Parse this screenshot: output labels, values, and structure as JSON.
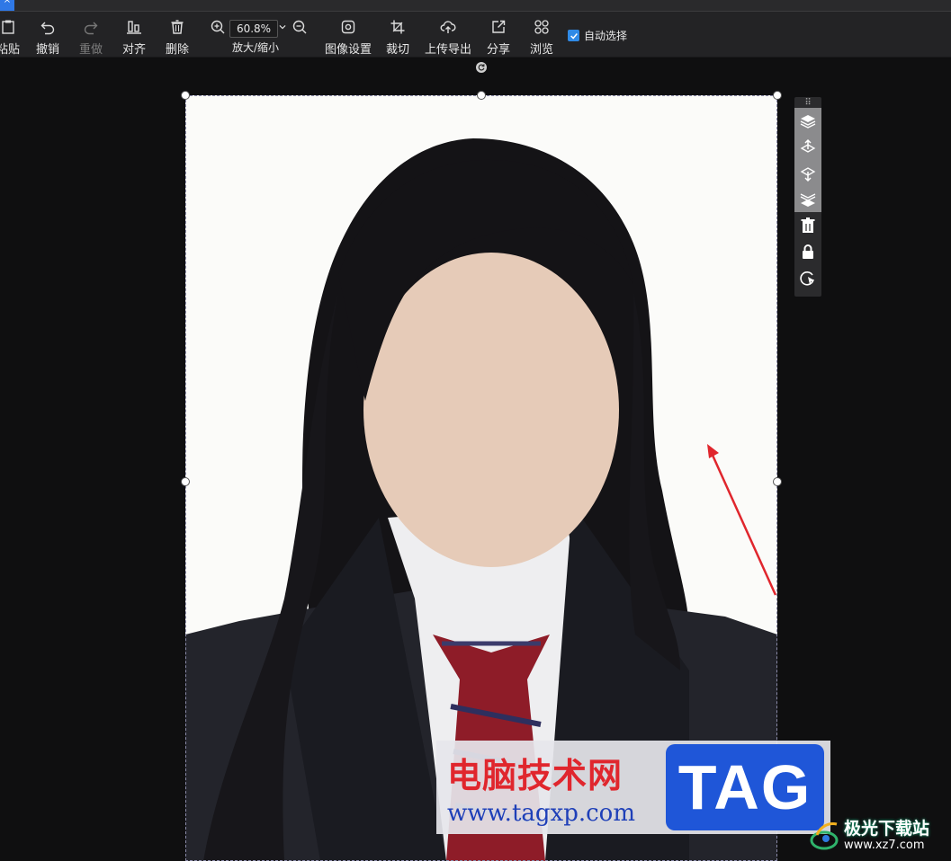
{
  "top_tab_glyph": "^",
  "toolbar": {
    "items": [
      {
        "label": "粘贴",
        "icon": "paste-icon"
      },
      {
        "label": "撤销",
        "icon": "undo-icon"
      },
      {
        "label": "重做",
        "icon": "redo-icon"
      },
      {
        "label": "对齐",
        "icon": "align-icon"
      },
      {
        "label": "删除",
        "icon": "trash-icon"
      },
      {
        "label": "放大/缩小",
        "icon": "zoom-icon"
      },
      {
        "label": "图像设置",
        "icon": "image-settings-icon"
      },
      {
        "label": "裁切",
        "icon": "crop-icon"
      },
      {
        "label": "上传导出",
        "icon": "upload-icon"
      },
      {
        "label": "分享",
        "icon": "share-icon"
      },
      {
        "label": "浏览",
        "icon": "browse-icon"
      }
    ],
    "zoom_value": "60.8%",
    "auto_select_label": "自动选择",
    "auto_select_checked": true
  },
  "float_panel": {
    "items": [
      "layer-top-icon",
      "move-up-icon",
      "move-down-icon",
      "layer-bottom-icon",
      "trash-icon",
      "lock-icon",
      "reset-icon"
    ]
  },
  "watermark": {
    "cn_text": "电脑技术网",
    "url_text": "www.tagxp.com",
    "tag_text": "TAG"
  },
  "corner_watermark": {
    "cn_text": "极光下载站",
    "url_text": "www.xz7.com"
  },
  "colors": {
    "accent": "#2f8ae6",
    "annotation_arrow": "#e0262d"
  }
}
